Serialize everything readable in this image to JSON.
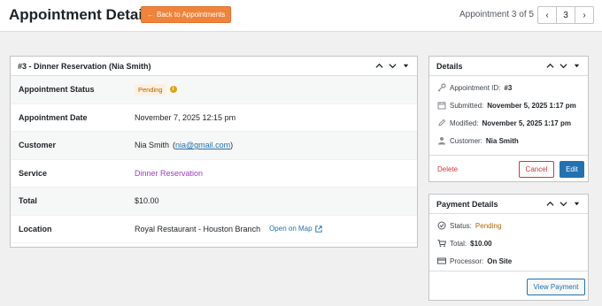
{
  "header": {
    "title": "Appointment Details",
    "back_label": "Back to Appointments",
    "counter": "Appointment 3 of 5",
    "page": "3"
  },
  "main": {
    "title": "#3 - Dinner Reservation (Nia Smith)",
    "rows": {
      "status": {
        "label": "Appointment Status",
        "value": "Pending"
      },
      "date": {
        "label": "Appointment Date",
        "value": "November 7, 2025 12:15 pm"
      },
      "customer": {
        "label": "Customer",
        "name": "Nia Smith",
        "email": "nia@gmail.com"
      },
      "service": {
        "label": "Service",
        "value": "Dinner Reservation"
      },
      "total": {
        "label": "Total",
        "value": "$10.00"
      },
      "location": {
        "label": "Location",
        "value": "Royal Restaurant - Houston Branch",
        "map_label": "Open on Map"
      }
    }
  },
  "details": {
    "title": "Details",
    "id_label": "Appointment ID:",
    "id_value": "#3",
    "submitted_label": "Submitted:",
    "submitted_value": "November 5, 2025 1:17 pm",
    "modified_label": "Modified:",
    "modified_value": "November 5, 2025 1:17 pm",
    "customer_label": "Customer:",
    "customer_value": "Nia Smith",
    "delete_label": "Delete",
    "cancel_label": "Cancel",
    "edit_label": "Edit"
  },
  "payment": {
    "title": "Payment Details",
    "status_label": "Status:",
    "status_value": "Pending",
    "total_label": "Total:",
    "total_value": "$10.00",
    "processor_label": "Processor:",
    "processor_value": "On Site",
    "view_label": "View Payment"
  },
  "colors": {
    "accent": "#f0833a",
    "primary": "#2271b1",
    "danger": "#d63638",
    "pending": "#b26200"
  }
}
